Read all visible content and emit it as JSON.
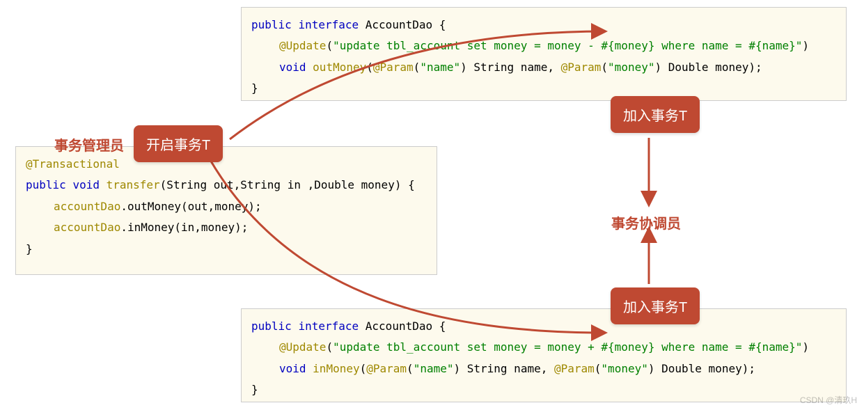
{
  "labels": {
    "manager": "事务管理员",
    "coordinator": "事务协调员"
  },
  "badges": {
    "open": "开启事务T",
    "join1": "加入事务T",
    "join2": "加入事务T"
  },
  "top_box": {
    "kw_public": "public",
    "kw_interface": "interface",
    "class_name": "AccountDao",
    "brace_open": "{",
    "annotation": "@Update",
    "paren_open": "(",
    "sql": "\"update tbl_account set money = money - #{money} where name = #{name}\"",
    "paren_close": ")",
    "kw_void": "void",
    "method": "outMoney",
    "param1_annot": "@Param",
    "param1_str": "\"name\"",
    "param1_type": "String name",
    "param2_annot": "@Param",
    "param2_str": "\"money\"",
    "param2_type": "Double money",
    "semi": ";",
    "brace_close": "}"
  },
  "left_box": {
    "annotation": "@Transactional",
    "kw_public": "public",
    "kw_void": "void",
    "method": "transfer",
    "params": "(String out,String in ,Double money) {",
    "line1_obj": "accountDao",
    "line1_call": ".outMoney(out,money);",
    "line2_obj": "accountDao",
    "line2_call": ".inMoney(in,money);",
    "brace_close": "}"
  },
  "bottom_box": {
    "kw_public": "public",
    "kw_interface": "interface",
    "class_name": "AccountDao",
    "brace_open": "{",
    "annotation": "@Update",
    "paren_open": "(",
    "sql": "\"update tbl_account set money = money + #{money} where name = #{name}\"",
    "paren_close": ")",
    "kw_void": "void",
    "method": "inMoney",
    "param1_annot": "@Param",
    "param1_str": "\"name\"",
    "param1_type": "String name",
    "param2_annot": "@Param",
    "param2_str": "\"money\"",
    "param2_type": "Double money",
    "semi": ";",
    "brace_close": "}"
  },
  "watermark": "CSDN @清玖H"
}
